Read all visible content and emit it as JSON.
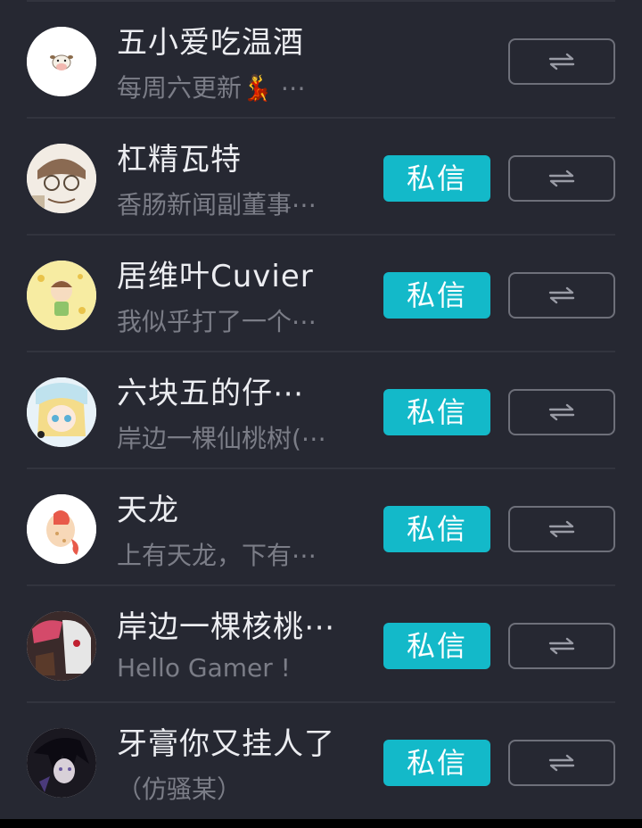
{
  "following_list": [
    {
      "name": "五小爱吃温酒",
      "bio": "每周六更新💃 ⋯",
      "dm_label": "",
      "follow_icon": "mutual-follow-icon",
      "avatar": "cow-emoji-avatar"
    },
    {
      "name": "杠精瓦特",
      "bio": "香肠新闻副董事⋯",
      "dm_label": "私信",
      "follow_icon": "mutual-follow-icon",
      "avatar": "anime-boy-glasses-avatar"
    },
    {
      "name": "居维叶Cuvier",
      "bio": "我似乎打了一个⋯",
      "dm_label": "私信",
      "follow_icon": "mutual-follow-icon",
      "avatar": "cartoon-kid-yellow-avatar"
    },
    {
      "name": "六块五的仔⋯",
      "bio": "岸边一棵仙桃树(⋯",
      "dm_label": "私信",
      "follow_icon": "mutual-follow-icon",
      "avatar": "anime-blonde-girl-avatar"
    },
    {
      "name": "天龙",
      "bio": "上有天龙，下有⋯",
      "dm_label": "私信",
      "follow_icon": "mutual-follow-icon",
      "avatar": "dragon-egg-avatar"
    },
    {
      "name": "岸边一棵核桃⋯",
      "bio": "Hello Gamer !",
      "dm_label": "私信",
      "follow_icon": "mutual-follow-icon",
      "avatar": "masked-character-avatar"
    },
    {
      "name": "牙膏你又挂人了",
      "bio": "（仿骚某）",
      "dm_label": "私信",
      "follow_icon": "mutual-follow-icon",
      "avatar": "dark-anime-avatar"
    }
  ],
  "colors": {
    "background": "#262832",
    "accent": "#13b9c9",
    "name_text": "#ecedf1",
    "bio_text": "#7b7d87",
    "divider": "#32343e"
  }
}
